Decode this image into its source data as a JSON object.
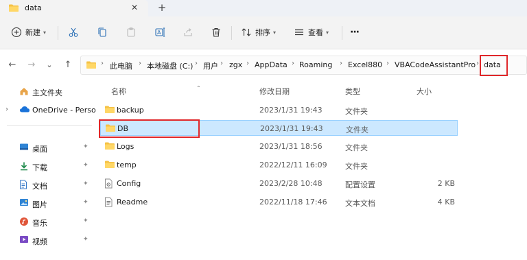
{
  "tab": {
    "title": "data",
    "close": "✕",
    "new": "+"
  },
  "toolbar": {
    "new_label": "新建",
    "sort_label": "排序",
    "view_label": "查看",
    "more": "···"
  },
  "nav": {
    "back": "←",
    "forward": "→",
    "recent": "⌄",
    "up": "↑"
  },
  "breadcrumb": [
    "此电脑",
    "本地磁盘 (C:)",
    "用户",
    "zgx",
    "AppData",
    "Roaming",
    "Excel880",
    "VBACodeAssistantPro",
    "data"
  ],
  "sidebar": {
    "items": [
      {
        "label": "主文件夹",
        "icon": "home-icon"
      },
      {
        "label": "OneDrive - Perso",
        "icon": "cloud-icon"
      },
      {
        "label": "桌面",
        "icon": "desktop-icon"
      },
      {
        "label": "下载",
        "icon": "download-icon"
      },
      {
        "label": "文档",
        "icon": "document-icon"
      },
      {
        "label": "图片",
        "icon": "pictures-icon"
      },
      {
        "label": "音乐",
        "icon": "music-icon"
      },
      {
        "label": "视频",
        "icon": "video-icon"
      }
    ]
  },
  "columns": {
    "name": "名称",
    "modified": "修改日期",
    "type": "类型",
    "size": "大小"
  },
  "files": [
    {
      "name": "backup",
      "modified": "2023/1/31 19:43",
      "type": "文件夹",
      "size": "",
      "icon": "folder-icon"
    },
    {
      "name": "DB",
      "modified": "2023/1/31 19:43",
      "type": "文件夹",
      "size": "",
      "icon": "folder-icon"
    },
    {
      "name": "Logs",
      "modified": "2023/1/31 18:56",
      "type": "文件夹",
      "size": "",
      "icon": "folder-icon"
    },
    {
      "name": "temp",
      "modified": "2022/12/11 16:09",
      "type": "文件夹",
      "size": "",
      "icon": "folder-icon"
    },
    {
      "name": "Config",
      "modified": "2023/2/28 10:48",
      "type": "配置设置",
      "size": "2 KB",
      "icon": "config-file-icon"
    },
    {
      "name": "Readme",
      "modified": "2022/11/18 17:46",
      "type": "文本文档",
      "size": "4 KB",
      "icon": "text-file-icon"
    }
  ],
  "colors": {
    "accent": "#0067c0",
    "selection": "#cce8ff",
    "highlight": "#e0272a",
    "folder": "#f5c245"
  }
}
